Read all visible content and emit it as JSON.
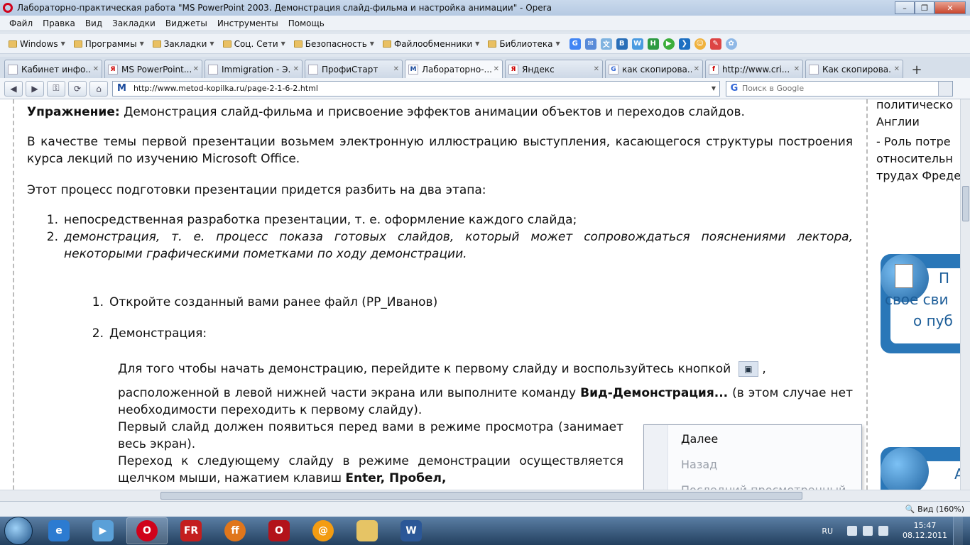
{
  "window": {
    "title": "Лабораторно-практическая работа \"MS PowerPoint 2003. Демонстрация слайд-фильма и настройка анимации\" - Opera",
    "min": "–",
    "max": "❐",
    "close": "✕"
  },
  "menu": [
    "Файл",
    "Правка",
    "Вид",
    "Закладки",
    "Виджеты",
    "Инструменты",
    "Помощь"
  ],
  "bookmarks": [
    "Windows",
    "Программы",
    "Закладки",
    "Соц. Сети",
    "Безопасность",
    "Файлообменники",
    "Библиотека"
  ],
  "tabs": [
    {
      "label": "Кабинет инфо...",
      "fav": ""
    },
    {
      "label": "MS PowerPoint...",
      "fav": "Я"
    },
    {
      "label": "Immigration - Э...",
      "fav": ""
    },
    {
      "label": "ПрофиСтарт",
      "fav": ""
    },
    {
      "label": "Лабораторно-...",
      "fav": "M"
    },
    {
      "label": "Яндекс",
      "fav": "Я"
    },
    {
      "label": "как скопирова...",
      "fav": "G"
    },
    {
      "label": "http://www.cri...",
      "fav": "f"
    },
    {
      "label": "Как скопирова...",
      "fav": ""
    }
  ],
  "address": {
    "url": "http://www.metod-kopilka.ru/page-2-1-6-2.html",
    "site_icon": "M"
  },
  "search": {
    "placeholder": "Поиск в Google"
  },
  "content": {
    "exercise_label": "Упражнение:",
    "exercise_text": " Демонстрация слайд-фильма и присвоение эффектов анимации объектов и переходов слайдов.",
    "para1": "В качестве темы первой презентации возьмем электронную иллюстрацию выступления, касающегося структуры построения курса лекций по изучению Microsoft Office.",
    "para2": "Этот процесс подготовки презентации придется разбить на два этапа:",
    "list1": [
      {
        "num": "1.",
        "text": "непосредственная разработка презентации, т. е. оформление каждого слайда;"
      },
      {
        "num": "2.",
        "text": "демонстрация, т. е. процесс показа готовых слайдов, который может сопровождаться пояснениями лектора, некоторыми графическими пометками по ходу демонстрации."
      }
    ],
    "list2": [
      {
        "num": "1.",
        "text": "Откройте созданный вами ранее файл (PP_Иванов)"
      },
      {
        "num": "2.",
        "text": "Демонстрация:"
      }
    ],
    "demo_p1_a": "Для того чтобы начать демонстрацию, перейдите к первому слайду и воспользуйтесь кнопкой",
    "demo_p1_b": ",",
    "demo_p2_a": "расположенной в левой нижней части экрана или выполните команду ",
    "demo_p2_bold": "Вид-Демонстрация...",
    "demo_p2_c": " (в этом случае нет необходимости переходить к первому слайду).",
    "demo_p3": "Первый слайд должен появиться перед вами в режиме просмотра (занимает весь экран).",
    "demo_p4_a": "Переход к следующему слайду в режиме демонстрации осуществляется щелчком мыши, нажатием клавиш ",
    "demo_p4_bold": "Enter, Пробел,"
  },
  "context_menu": {
    "next": "Далее",
    "back": "Назад",
    "last": "Последний просмотренный"
  },
  "sidebar": {
    "lines": [
      "политическо",
      "Англии",
      "- Роль потре",
      "относительн",
      "трудах Фреде"
    ],
    "banner1": [
      "П",
      "свое сви",
      "о пуб"
    ],
    "banner2": [
      "А"
    ]
  },
  "status": {
    "zoom": "Вид (160%)"
  },
  "taskbar": {
    "lang": "RU",
    "time": "15:47",
    "date": "08.12.2011"
  }
}
